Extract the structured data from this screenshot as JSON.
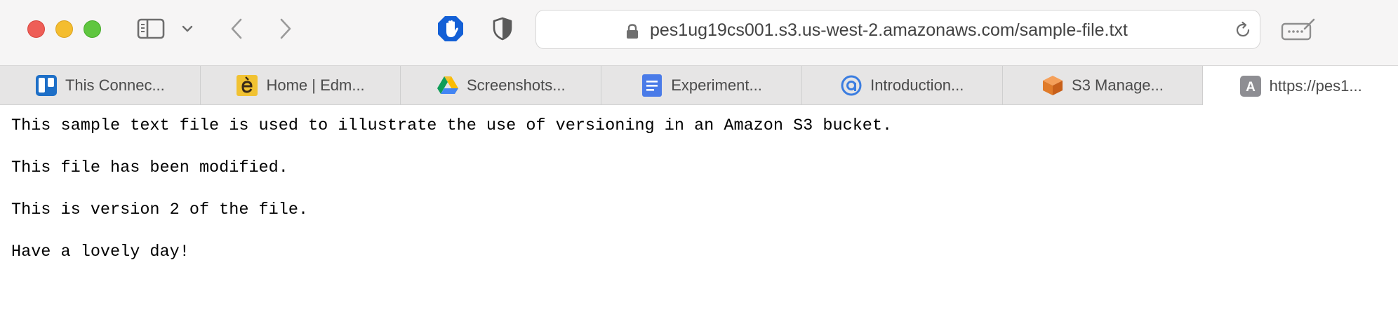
{
  "address_bar": {
    "url": "pes1ug19cs001.s3.us-west-2.amazonaws.com/sample-file.txt"
  },
  "tabs": [
    {
      "label": "This Connec...",
      "icon": "trello-icon"
    },
    {
      "label": "Home | Edm...",
      "icon": "edmodo-icon"
    },
    {
      "label": "Screenshots...",
      "icon": "google-drive-icon"
    },
    {
      "label": "Experiment...",
      "icon": "google-docs-icon"
    },
    {
      "label": "Introduction...",
      "icon": "at-sign-icon"
    },
    {
      "label": "S3 Manage...",
      "icon": "aws-s3-icon"
    },
    {
      "label": "https://pes1...",
      "icon": "letter-a-icon",
      "icon_letter": "A"
    }
  ],
  "document": {
    "lines": [
      "This sample text file is used to illustrate the use of versioning in an Amazon S3 bucket.",
      "This file has been modified.",
      "This is version 2 of the file.",
      "Have a lovely day!"
    ]
  },
  "colors": {
    "traffic_red": "#ee5e57",
    "traffic_yellow": "#f4bd2f",
    "traffic_green": "#5fc63f",
    "hand_extension": "#1460d6"
  }
}
